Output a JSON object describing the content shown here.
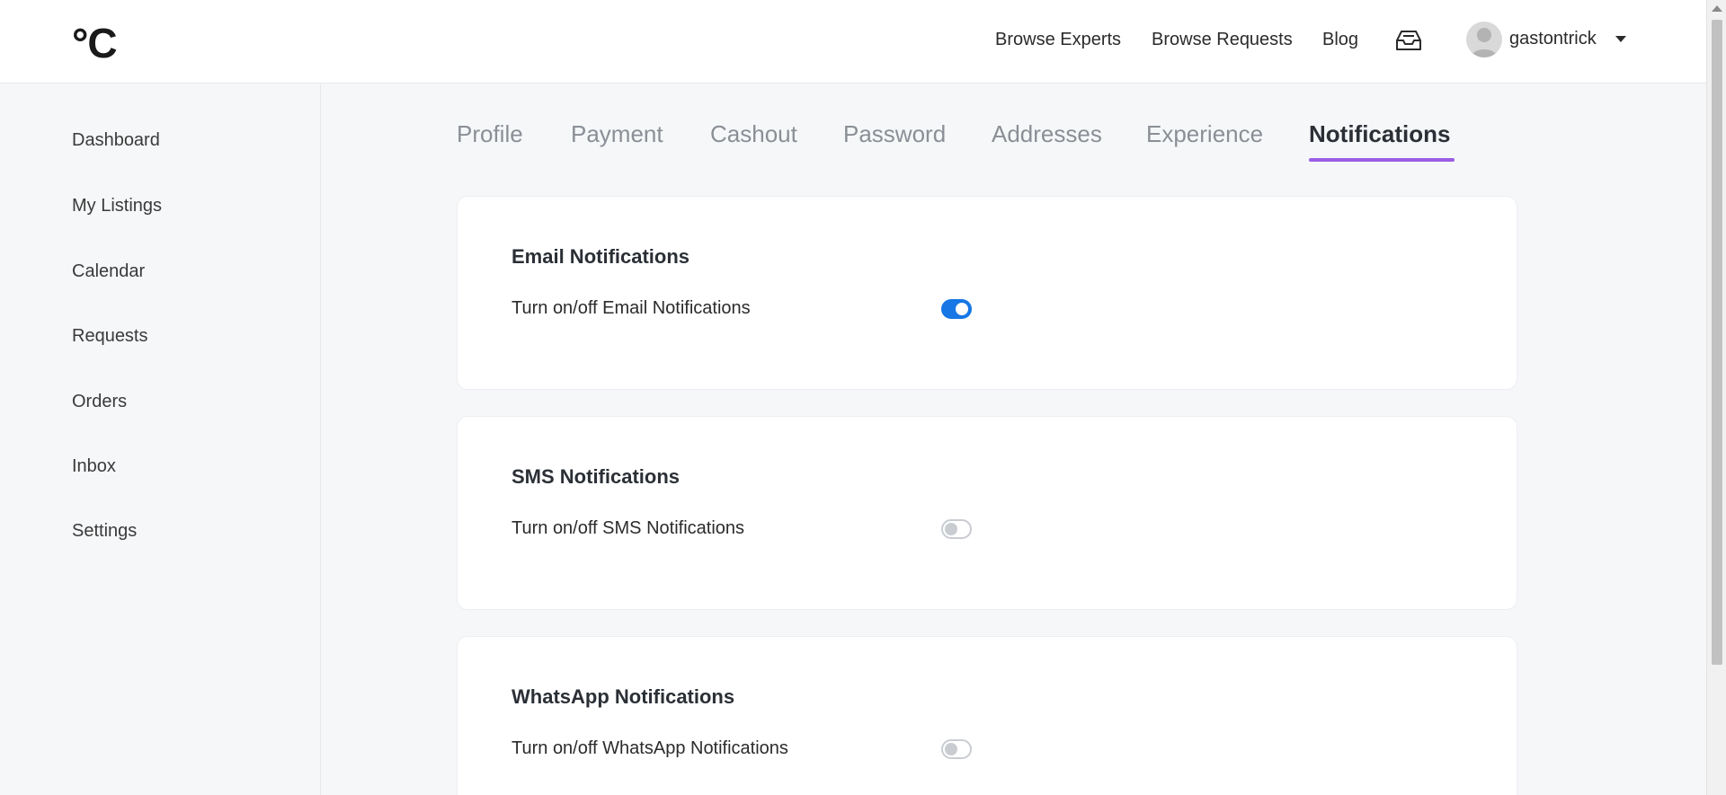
{
  "header": {
    "logo_text": "°C",
    "nav": [
      "Browse Experts",
      "Browse Requests",
      "Blog"
    ],
    "inbox_icon": "inbox-tray-icon",
    "avatar_icon": "user-avatar-icon",
    "username": "gastontrick",
    "dropdown_icon": "caret-down-icon"
  },
  "sidebar": {
    "items": [
      "Dashboard",
      "My Listings",
      "Calendar",
      "Requests",
      "Orders",
      "Inbox",
      "Settings"
    ]
  },
  "tabs": {
    "items": [
      "Profile",
      "Payment",
      "Cashout",
      "Password",
      "Addresses",
      "Experience",
      "Notifications"
    ],
    "active": "Notifications",
    "accent_color": "#9b5de5"
  },
  "notifications": [
    {
      "title": "Email Notifications",
      "label": "Turn on/off Email Notifications",
      "enabled": true
    },
    {
      "title": "SMS Notifications",
      "label": "Turn on/off SMS Notifications",
      "enabled": false
    },
    {
      "title": "WhatsApp Notifications",
      "label": "Turn on/off WhatsApp Notifications",
      "enabled": false
    }
  ],
  "colors": {
    "toggle_on": "#1677e5",
    "toggle_off": "#c9ccd1"
  }
}
